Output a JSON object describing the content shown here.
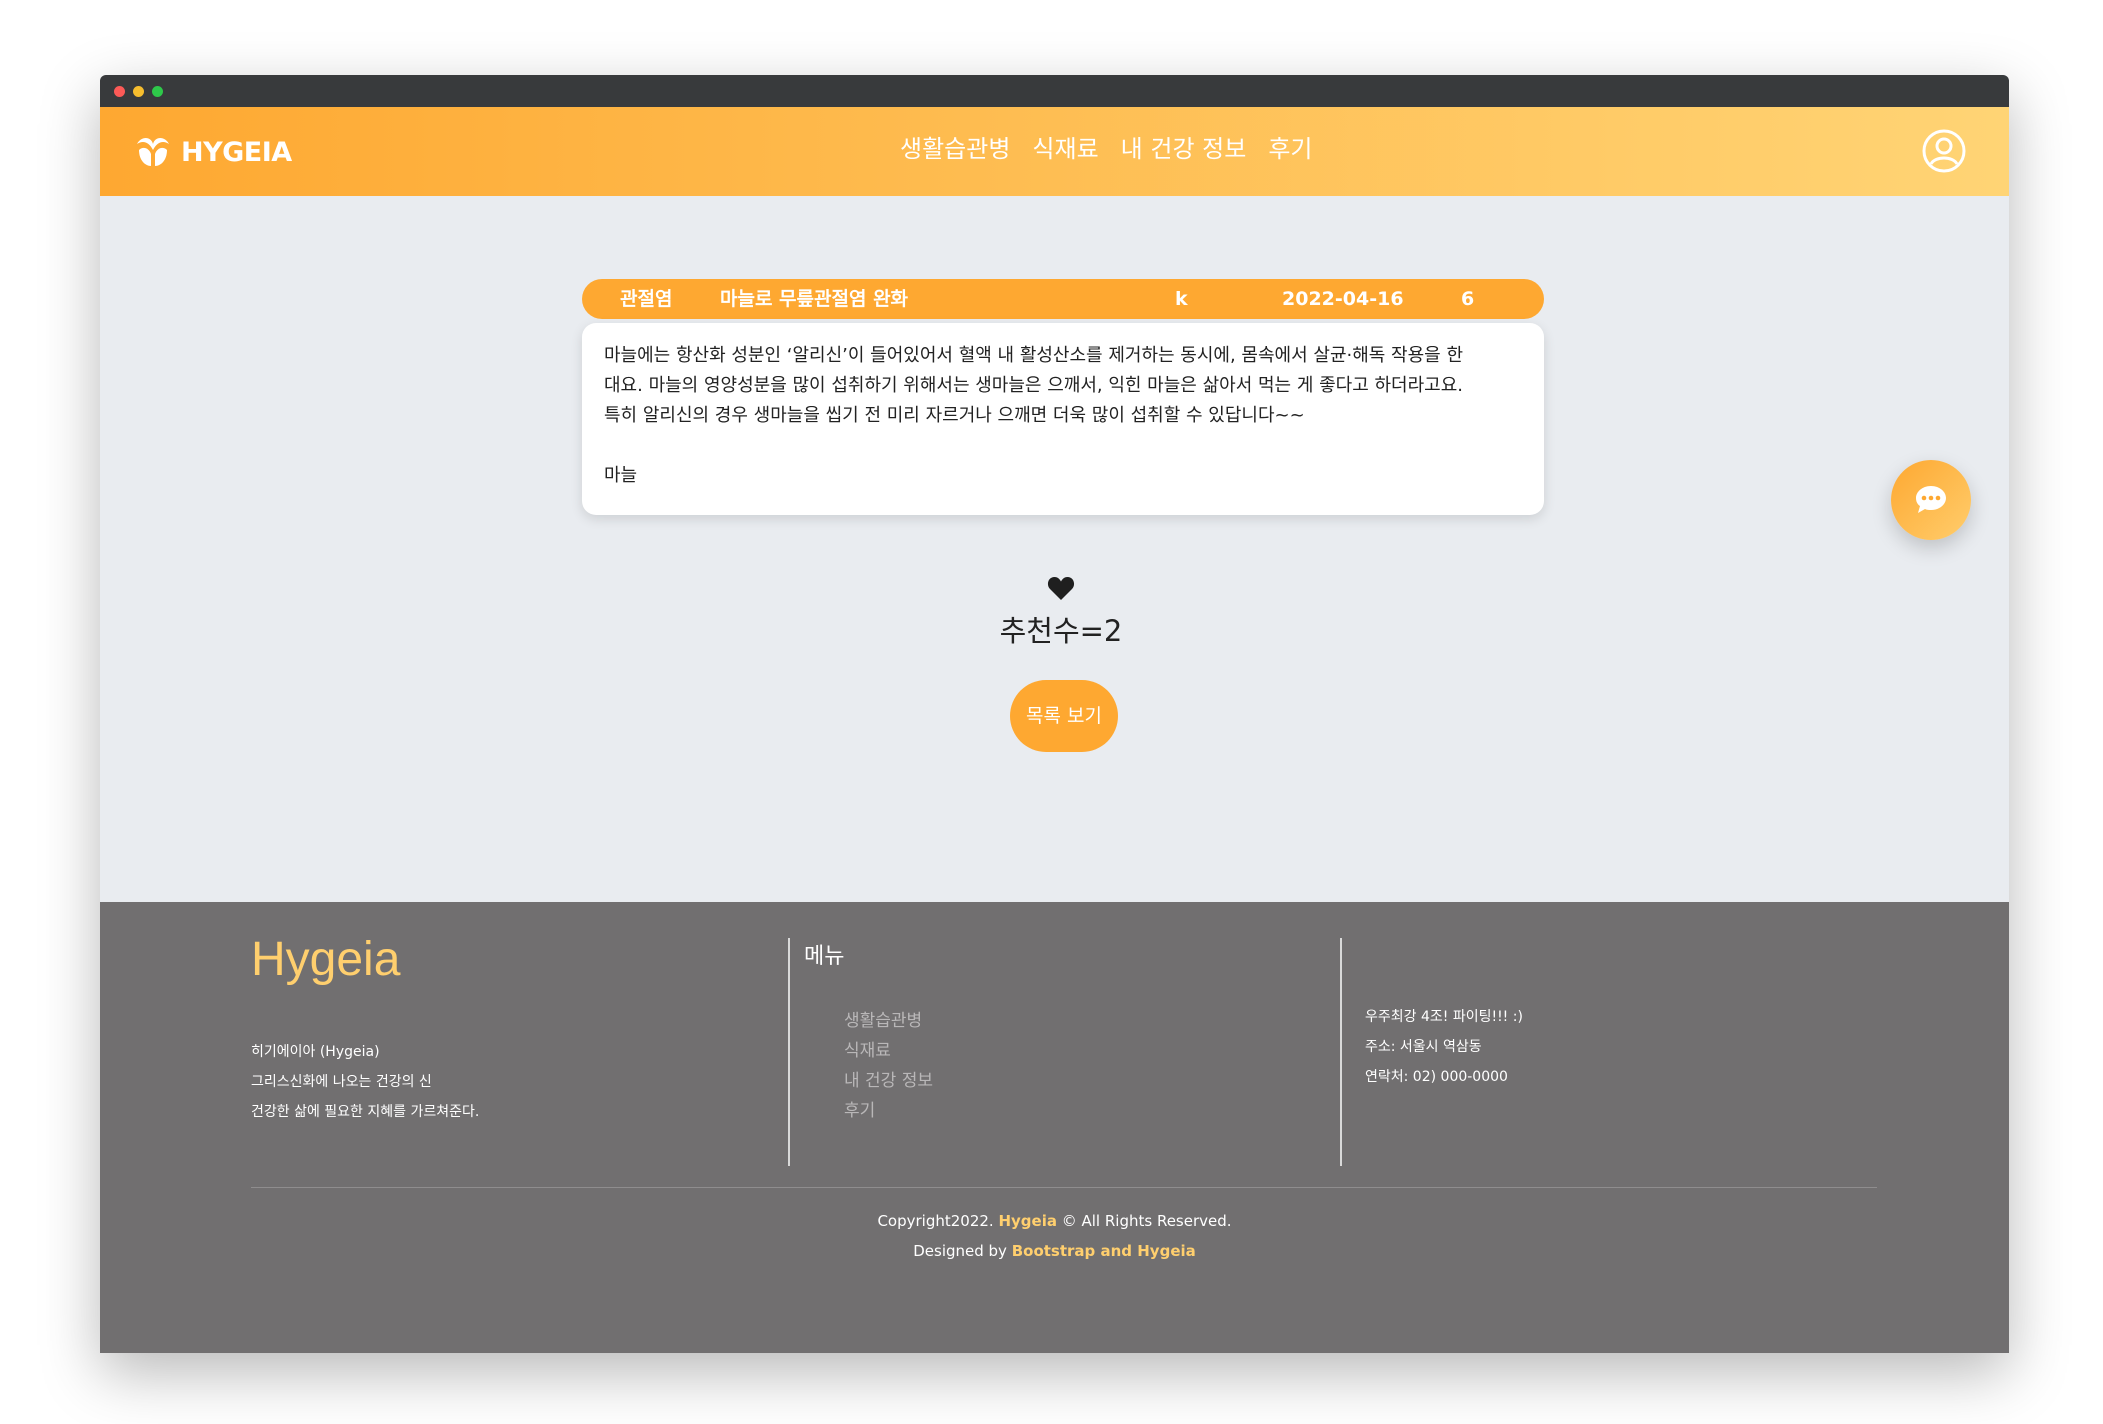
{
  "window": {
    "controls": [
      "close",
      "minimize",
      "maximize"
    ]
  },
  "navbar": {
    "brand": "HYGEIA",
    "links": [
      "생활습관병",
      "식재료",
      "내 건강 정보",
      "후기"
    ],
    "profile_icon": "user-circle-icon"
  },
  "post": {
    "category": "관절염",
    "title": "마늘로 무릎관절염 완화",
    "author": "k",
    "date": "2022-04-16",
    "views": "6",
    "body_lines": [
      "마늘에는 항산화 성분인 ‘알리신’이 들어있어서 혈액 내 활성산소를 제거하는 동시에, 몸속에서 살균·해독 작용을 한",
      "대요. 마늘의 영양성분을 많이 섭취하기 위해서는 생마늘은 으깨서, 익힌 마늘은 삶아서 먹는 게 좋다고 하더라고요.",
      "특히 알리신의 경우 생마늘을 씹기 전 미리 자르거나 으깨면 더욱 많이 섭취할 수 있답니다~~"
    ],
    "ingredient": "마늘"
  },
  "recommend": {
    "icon": "heart-icon",
    "label": "추천수=2"
  },
  "list_button": "목록 보기",
  "chat_button_icon": "chat-bubble-icon",
  "footer": {
    "title": "Hygeia",
    "desc_lines": [
      "히기에이아 (Hygeia)",
      "그리스신화에 나오는 건강의 신",
      "건강한 삶에 필요한 지혜를 가르쳐준다."
    ],
    "menu_title": "메뉴",
    "menu_items": [
      "생활습관병",
      "식재료",
      "내 건강 정보",
      "후기"
    ],
    "contact_lines": [
      "우주최강 4조! 파이팅!!! :)",
      "주소: 서울시 역삼동",
      "연락처: 02) 000-0000"
    ],
    "copyright_prefix": "Copyright2022. ",
    "copyright_brand": "Hygeia",
    "copyright_suffix": " © All Rights Reserved.",
    "designed_prefix": "Designed by ",
    "designed_by": "Bootstrap and Hygeia"
  },
  "colors": {
    "accent": "#fea831",
    "accent_light": "#ffd475",
    "footer_bg": "#716f70",
    "footer_highlight": "#ffcf6e"
  }
}
